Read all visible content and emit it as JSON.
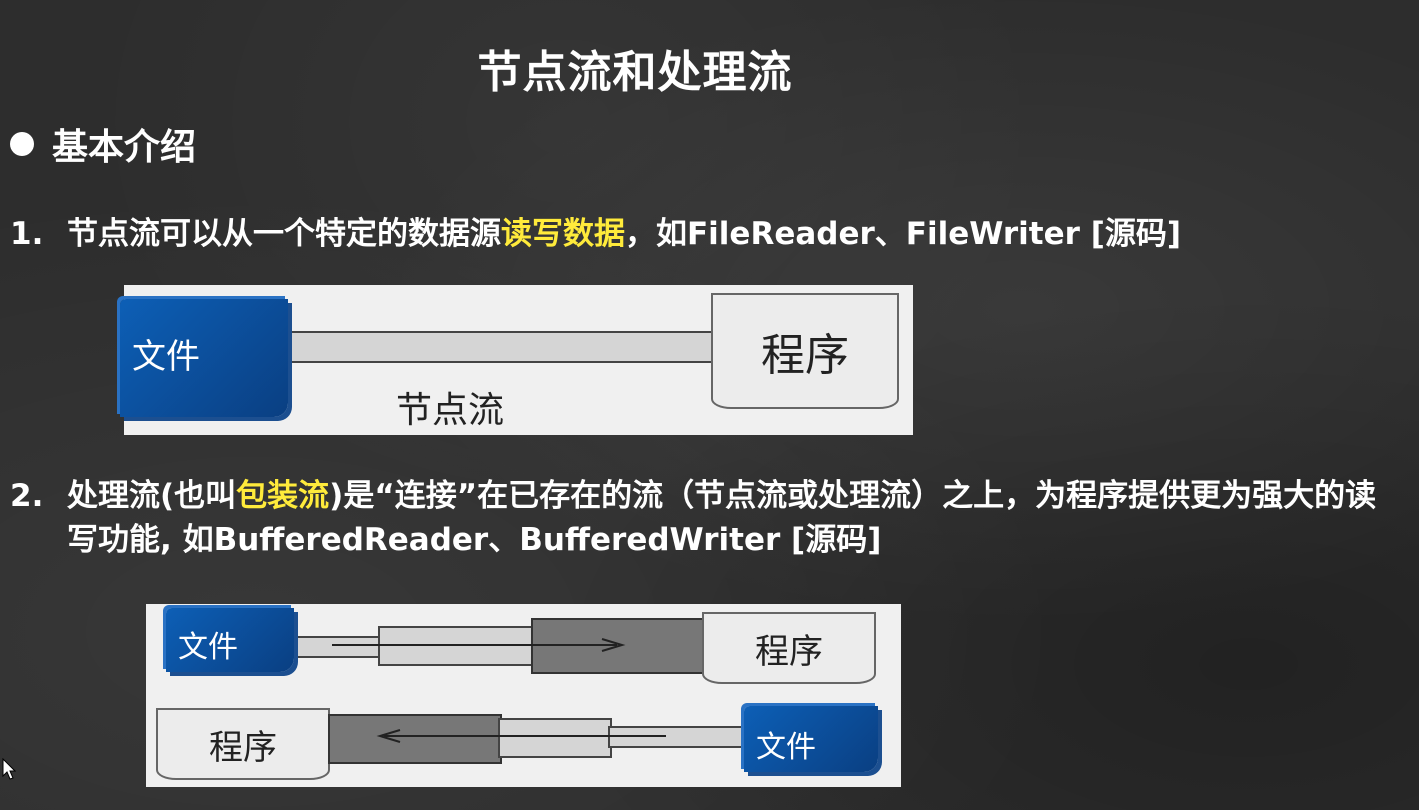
{
  "slide": {
    "title": "节点流和处理流",
    "bullet": "基本介绍",
    "item1": {
      "num": "1.",
      "pre": "节点流可以从一个特定的数据源",
      "highlight": "读写数据",
      "post": "，如FileReader、FileWriter [源码]"
    },
    "item2": {
      "num": "2.",
      "pre": "处理流(也叫",
      "highlight": "包装流",
      "post": ")是“连接”在已存在的流（节点流或处理流）之上，为程序提供更为强大的读写功能, 如BufferedReader、BufferedWriter [源码]"
    }
  },
  "diagram1": {
    "file_label": "文件",
    "program_label": "程序",
    "stream_label": "节点流"
  },
  "diagram2": {
    "top": {
      "file_label": "文件",
      "program_label": "程序"
    },
    "bottom": {
      "file_label": "文件",
      "program_label": "程序"
    }
  },
  "colors": {
    "highlight": "#ffeb3b",
    "file_blue": "#0d5fb6"
  }
}
